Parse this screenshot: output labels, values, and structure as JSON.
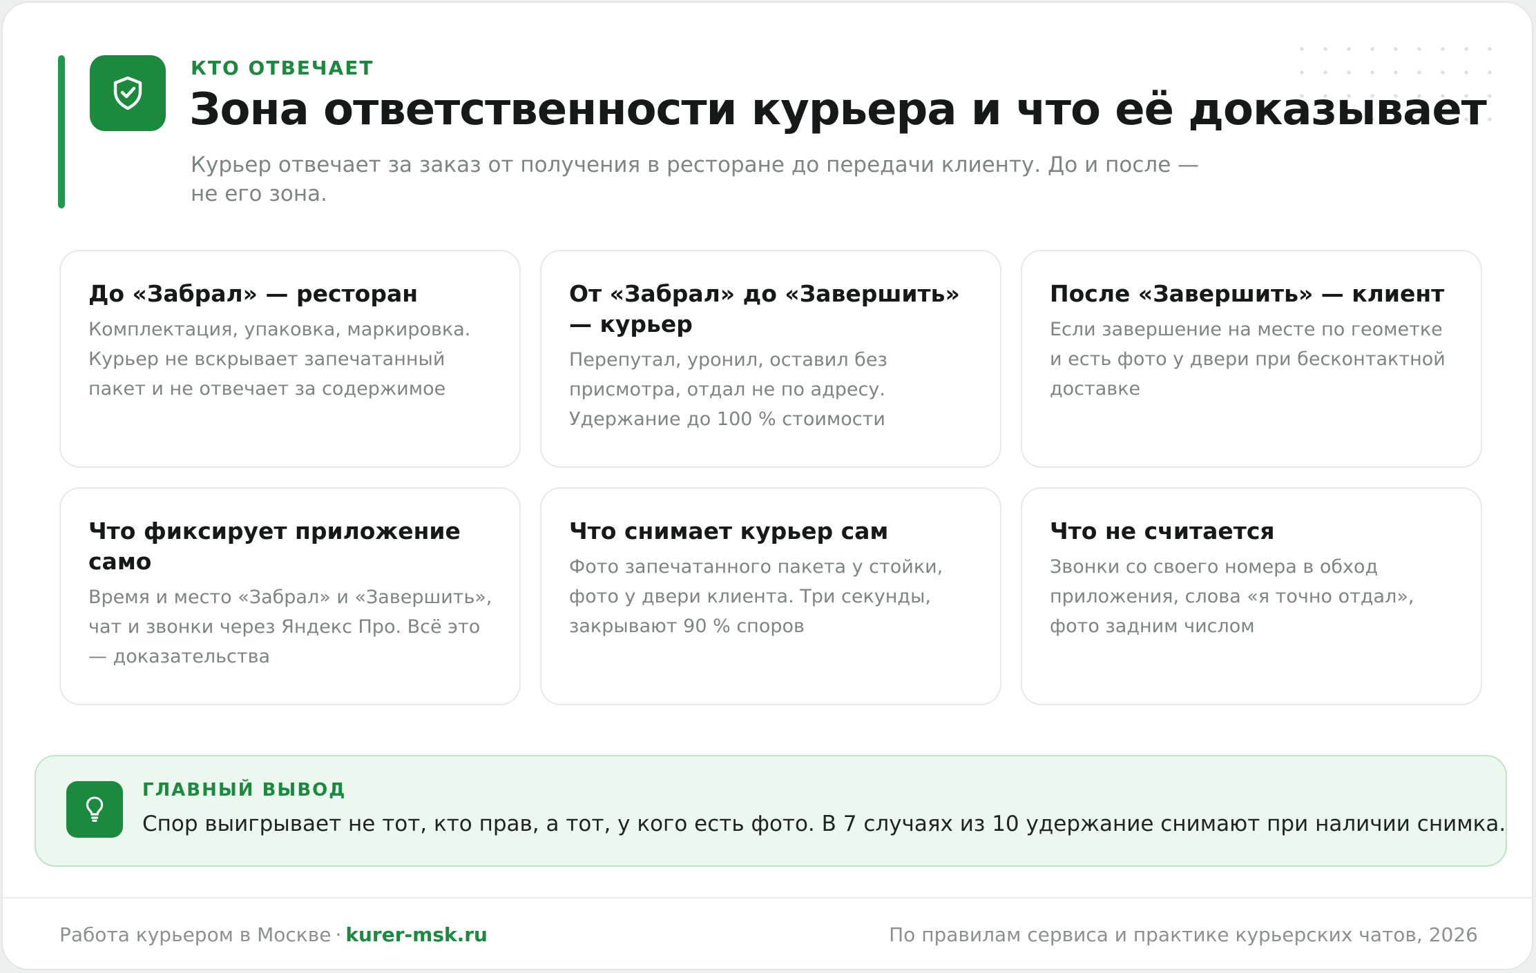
{
  "header": {
    "kicker": "КТО ОТВЕЧАЕТ",
    "title": "Зона ответственности курьера и что её доказывает",
    "subtitle": "Курьер отвечает за заказ от получения в ресторане до передачи клиенту. До и после — не его зона.",
    "icon": "shield-check-icon"
  },
  "tiles": [
    {
      "title": "До «Забрал» — ресторан",
      "text": "Комплектация, упаковка, маркировка. Курьер не вскрывает запечатанный пакет и не отвечает за содержимое"
    },
    {
      "title": "От «Забрал» до «Завершить» — курьер",
      "text": "Перепутал, уронил, оставил без присмотра, отдал не по адресу. Удержание до 100 % стоимости"
    },
    {
      "title": "После «Завершить» — клиент",
      "text": "Если завершение на месте по геометке и есть фото у двери при бесконтактной доставке"
    },
    {
      "title": "Что фиксирует приложение само",
      "text": "Время и место «Забрал» и «Завершить», чат и звонки через Яндекс Про. Всё это — доказательства"
    },
    {
      "title": "Что снимает курьер сам",
      "text": "Фото запечатанного пакета у стойки, фото у двери клиента. Три секунды, закрывают 90 % споров"
    },
    {
      "title": "Что не считается",
      "text": "Звонки со своего номера в обход приложения, слова «я точно отдал», фото задним числом"
    }
  ],
  "takeaway": {
    "label": "ГЛАВНЫЙ ВЫВОД",
    "text": "Спор выигрывает не тот, кто прав, а тот, у кого есть фото. В 7 случаях из 10 удержание снимают при наличии снимка.",
    "icon": "lightbulb-icon"
  },
  "footer": {
    "left_text": "Работа курьером в Москве",
    "separator": "·",
    "site": "kurer-msk.ru",
    "right_text": "По правилам сервиса и практике курьерских чатов, 2026"
  },
  "colors": {
    "accent": "#1b8a3f",
    "accent_light_bg": "#ecf7ef",
    "muted_text": "#7d8582"
  }
}
